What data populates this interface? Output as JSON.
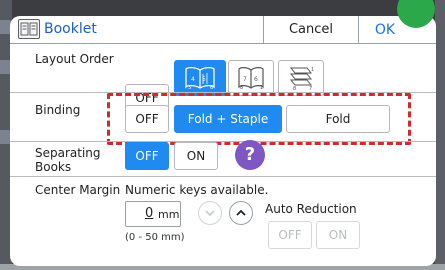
{
  "title": "Booklet",
  "buttons": {
    "cancel": "Cancel",
    "ok": "OK"
  },
  "layout_order": {
    "label": "Layout Order",
    "off": "OFF",
    "selected": "left-to-right",
    "options": [
      "left-to-right",
      "right-to-left",
      "top-to-bottom"
    ],
    "option_digits": {
      "left-to-right": [
        "4",
        "5",
        "3",
        "6"
      ],
      "right-to-left": [
        "7",
        "6",
        "8",
        "1"
      ],
      "top-to-bottom": [
        "1",
        "8",
        "7"
      ]
    }
  },
  "binding": {
    "label": "Binding",
    "options": [
      "OFF",
      "Fold + Staple",
      "Fold"
    ],
    "selected": "Fold + Staple"
  },
  "separating_books": {
    "label_line1": "Separating",
    "label_line2": "Books",
    "options": [
      "OFF",
      "ON"
    ],
    "selected": "OFF",
    "help": "?"
  },
  "center_margin": {
    "label": "Center Margin",
    "hint": "Numeric keys available.",
    "value": "0",
    "unit": "mm",
    "range": "(0 - 50 mm)",
    "auto_reduction": {
      "label": "Auto Reduction",
      "options": [
        "OFF",
        "ON"
      ]
    }
  },
  "colors": {
    "accent": "#1f8af0",
    "highlight": "#d12a2a",
    "help": "#7e57c2",
    "ok_indicator": "#2aa84a",
    "title_text": "#1a5fc8"
  }
}
